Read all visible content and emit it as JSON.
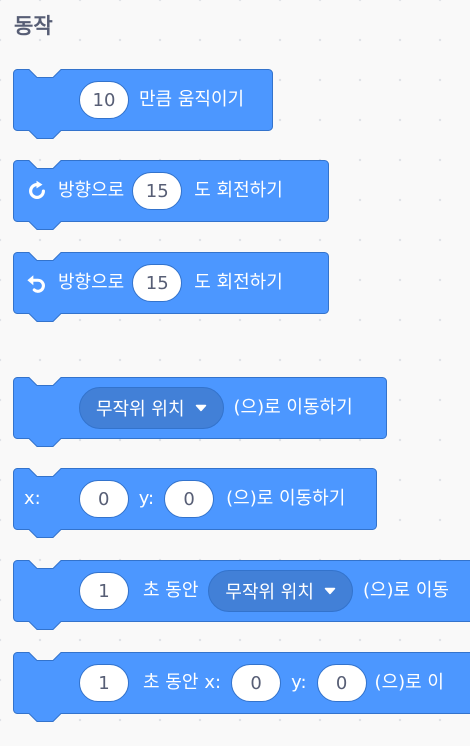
{
  "category": {
    "title": "동작"
  },
  "colors": {
    "block_fill": "#4c97ff",
    "block_stroke": "#3373cc",
    "input_text": "#575e75",
    "dropdown_fill": "#4280d7"
  },
  "blocks": [
    {
      "value": "10",
      "label": "만큼 움직이기"
    },
    {
      "icon": "turn-right-icon",
      "prefix": "방향으로",
      "value": "15",
      "suffix": "도 회전하기"
    },
    {
      "icon": "turn-left-icon",
      "prefix": "방향으로",
      "value": "15",
      "suffix": "도 회전하기"
    },
    {
      "dropdown": "무작위 위치",
      "suffix": "(으)로 이동하기"
    },
    {
      "x_label": "x:",
      "x_value": "0",
      "y_label": "y:",
      "y_value": "0",
      "suffix": "(으)로 이동하기"
    },
    {
      "seconds": "1",
      "seconds_label": "초 동안",
      "dropdown": "무작위 위치",
      "suffix": "(으)로 이동"
    },
    {
      "seconds": "1",
      "seconds_label": "초 동안",
      "x_label": "x:",
      "x_value": "0",
      "y_label": "y:",
      "y_value": "0",
      "suffix": "(으)로 이"
    }
  ]
}
